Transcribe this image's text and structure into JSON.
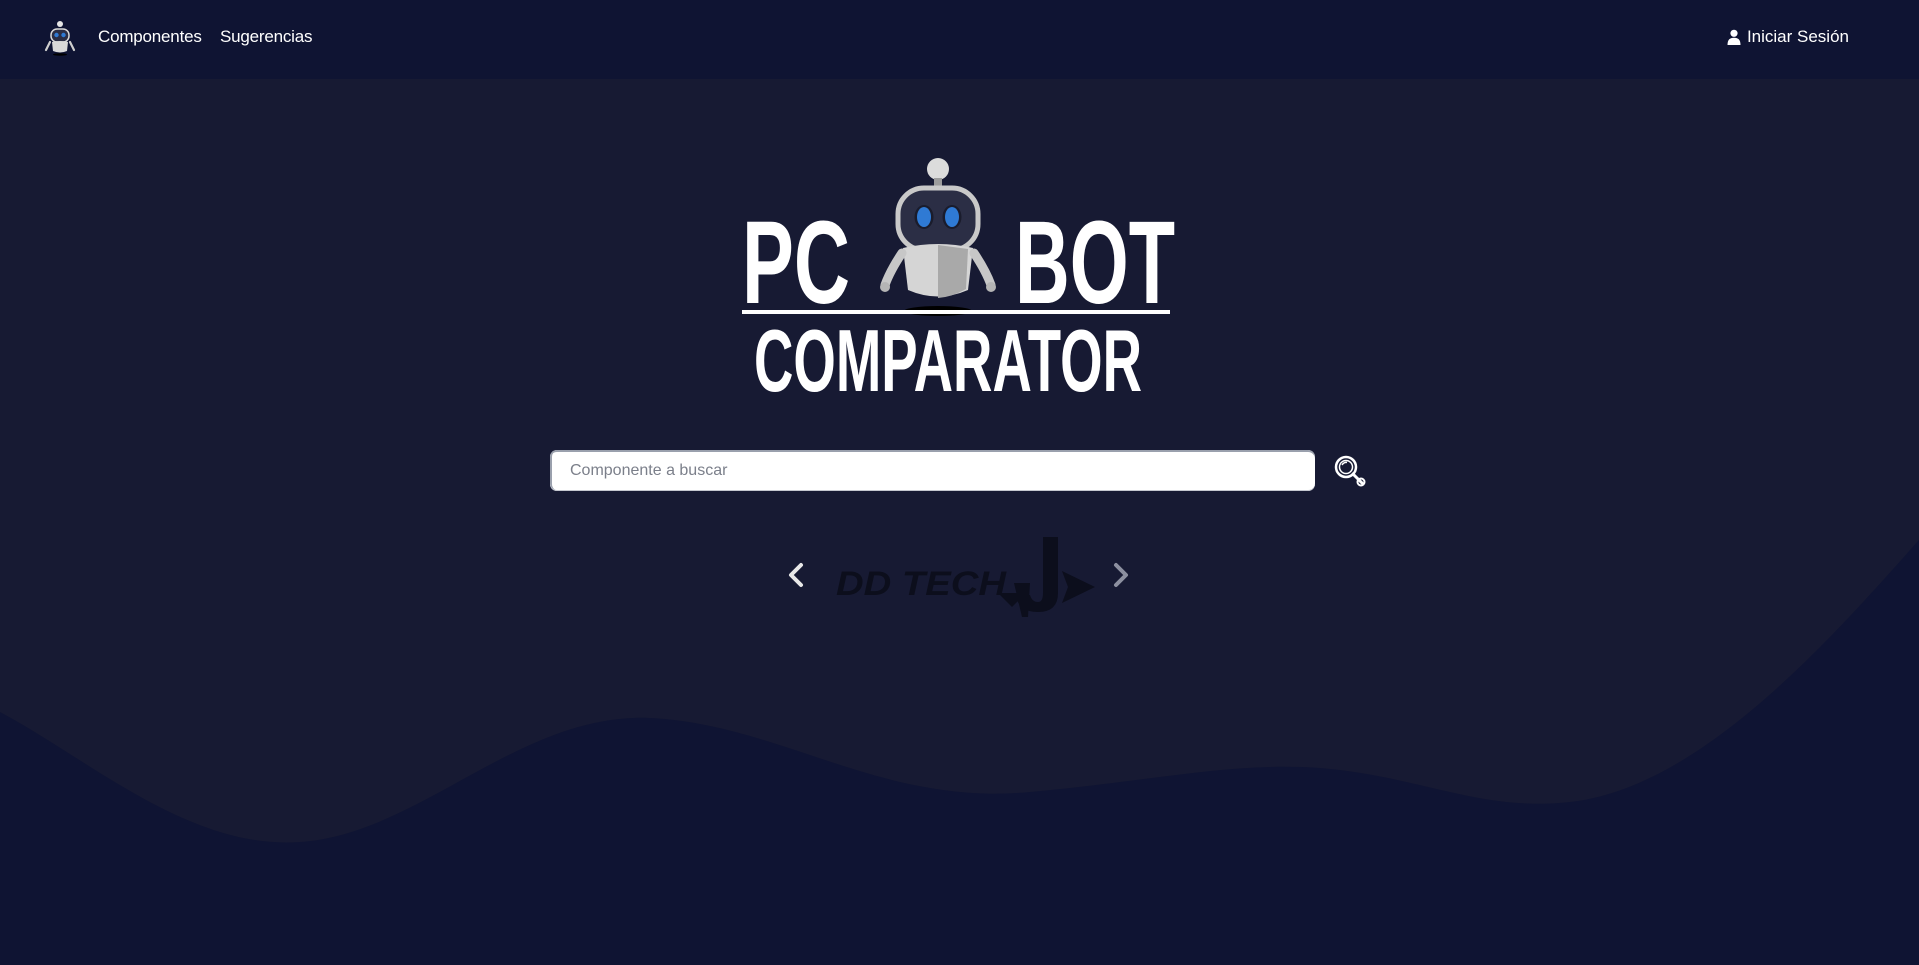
{
  "navbar": {
    "logo_icon": "robot-icon",
    "links": [
      {
        "label": "Componentes"
      },
      {
        "label": "Sugerencias"
      }
    ],
    "login_label": "Iniciar Sesión",
    "login_icon": "user-icon"
  },
  "hero": {
    "logo_text_left": "PC",
    "logo_text_right": "BOT",
    "logo_text_bottom": "COMPARATOR"
  },
  "search": {
    "placeholder": "Componente a buscar",
    "value": "",
    "button_icon": "magnifier-icon"
  },
  "carousel": {
    "brand_text": "DD TECH",
    "prev_icon": "chevron-left-icon",
    "next_icon": "chevron-right-icon"
  },
  "colors": {
    "navbar_bg": "#0f1433",
    "page_bg": "#171a33",
    "wave_bg": "#0f1433",
    "text": "#ffffff"
  }
}
